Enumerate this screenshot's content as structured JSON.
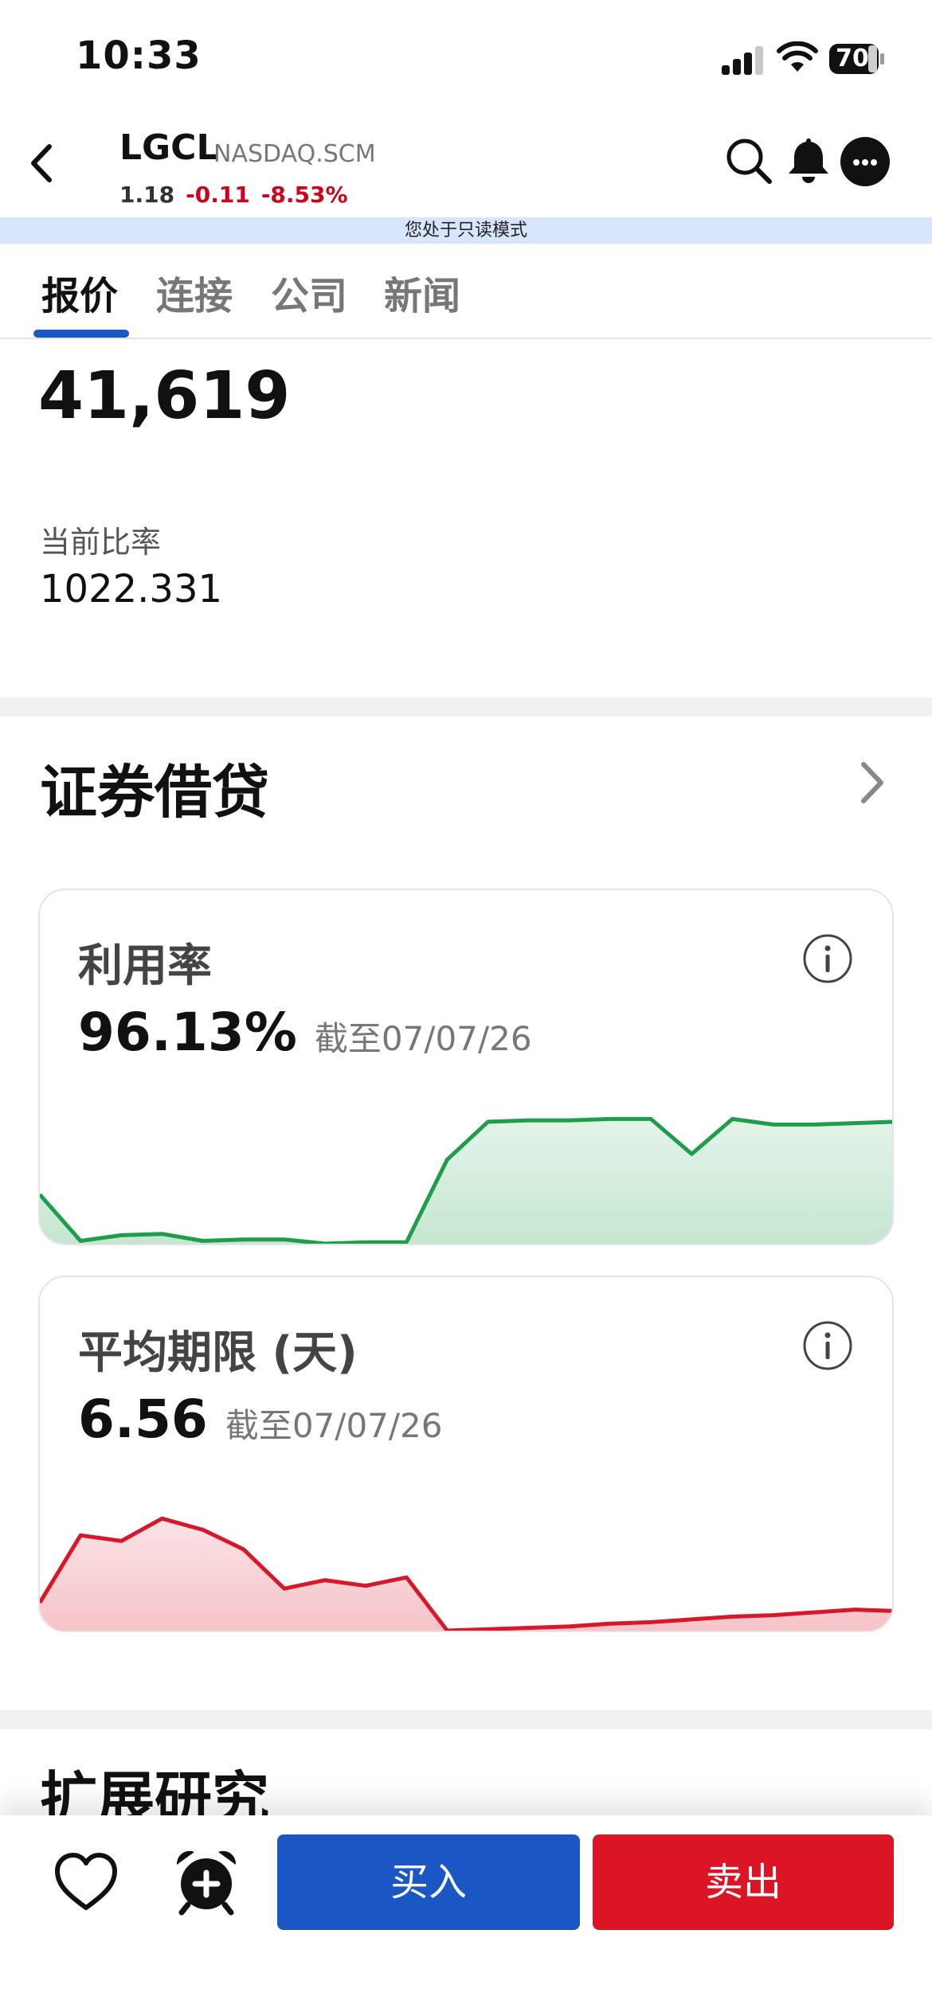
{
  "status_bar": {
    "time": "10:33",
    "battery": "70"
  },
  "header": {
    "ticker": "LGCL",
    "exchange": "NASDAQ.SCM",
    "price": "1.18",
    "change": "-0.11",
    "change_pct": "-8.53%"
  },
  "banner": {
    "readonly_text": "您处于只读模式"
  },
  "tabs": [
    {
      "label": "报价",
      "active": true
    },
    {
      "label": "连接",
      "active": false
    },
    {
      "label": "公司",
      "active": false
    },
    {
      "label": "新闻",
      "active": false
    }
  ],
  "summary": {
    "big_number": "41,619",
    "ratio_label": "当前比率",
    "ratio_value": "1022.331"
  },
  "securities_lending": {
    "title": "证券借贷",
    "cards": [
      {
        "title": "利用率",
        "value": "96.13%",
        "as_of": "截至07/07/26",
        "color": "#1e9e4a",
        "sparkline": [
          0.35,
          0.02,
          0.06,
          0.07,
          0.02,
          0.03,
          0.03,
          0.0,
          0.01,
          0.01,
          0.6,
          0.87,
          0.88,
          0.88,
          0.89,
          0.89,
          0.64,
          0.89,
          0.85,
          0.85,
          0.86,
          0.87
        ]
      },
      {
        "title": "平均期限 (天)",
        "value": "6.56",
        "as_of": "截至07/07/26",
        "color": "#d9172b",
        "sparkline": [
          0.2,
          0.68,
          0.64,
          0.8,
          0.72,
          0.58,
          0.3,
          0.36,
          0.32,
          0.38,
          0.0,
          0.01,
          0.02,
          0.03,
          0.05,
          0.06,
          0.08,
          0.1,
          0.11,
          0.13,
          0.15,
          0.14
        ]
      }
    ]
  },
  "extended_research": {
    "title": "扩展研究"
  },
  "bottom_bar": {
    "buy_label": "买入",
    "sell_label": "卖出"
  },
  "colors": {
    "brand_blue": "#1a56c4",
    "sell_red": "#dc1526",
    "loss_red": "#d0021b",
    "banner_blue": "#d8e6fb"
  }
}
